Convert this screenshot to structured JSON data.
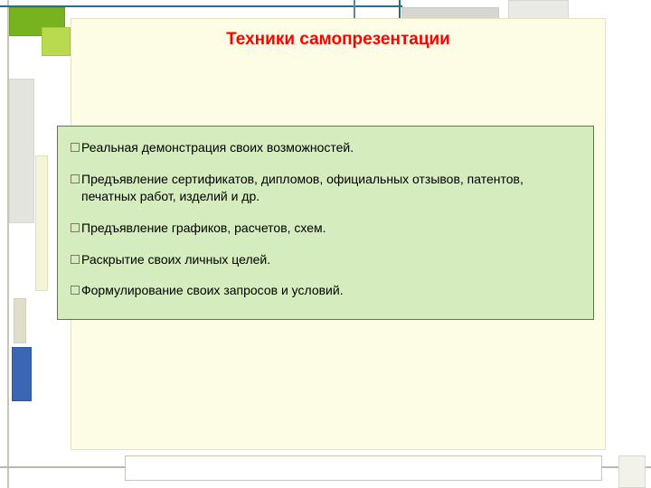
{
  "title": "Техники самопрезентации",
  "bullets": [
    "Реальная демонстрация своих возможностей.",
    "Предъявление сертификатов, дипломов, официальных отзывов, патентов, печатных работ, изделий и др.",
    "Предъявление графиков, расчетов, схем.",
    "Раскрытие своих личных целей.",
    "Формулирование своих запросов и условий."
  ]
}
